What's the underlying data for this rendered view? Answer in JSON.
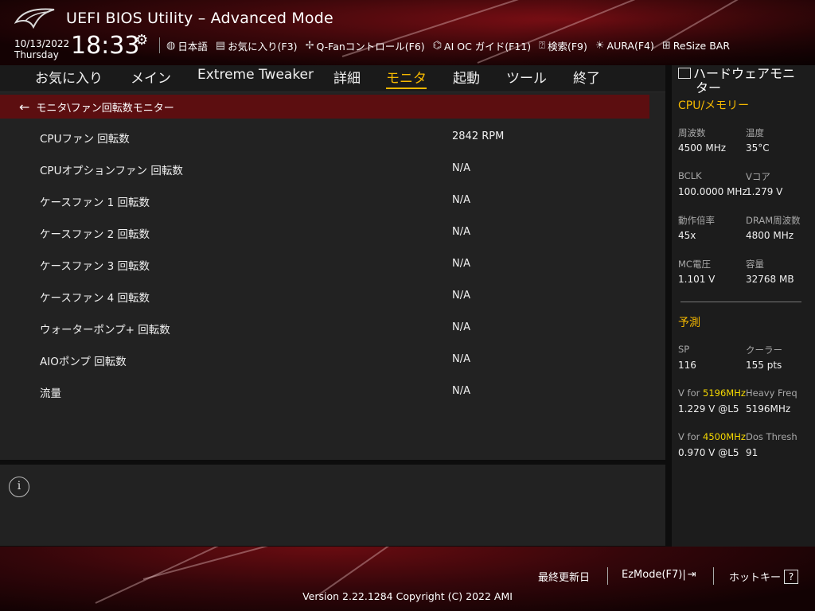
{
  "header": {
    "title": "UEFI BIOS Utility – Advanced Mode",
    "date": "10/13/2022",
    "day": "Thursday",
    "time": "18:33",
    "toolbar": [
      {
        "icon": "globe-icon",
        "label": "日本語"
      },
      {
        "icon": "favorites-icon",
        "label": "お気に入り(F3)"
      },
      {
        "icon": "fan-icon",
        "label": "Q-Fanコントロール(F6)"
      },
      {
        "icon": "ai-oc-icon",
        "label": "AI OC ガイド(F11)"
      },
      {
        "icon": "help-box-icon",
        "label": "検索(F9)"
      },
      {
        "icon": "aura-icon",
        "label": "AURA(F4)"
      },
      {
        "icon": "resize-bar-icon",
        "label": "ReSize BAR"
      }
    ]
  },
  "menu": {
    "items": [
      "お気に入り",
      "メイン",
      "Extreme Tweaker",
      "詳細",
      "モニタ",
      "起動",
      "ツール",
      "終了"
    ],
    "active": "モニタ"
  },
  "breadcrumb": "モニタ\\ファン回転数モニター",
  "rows": [
    {
      "label": "CPUファン 回転数",
      "value": "2842 RPM"
    },
    {
      "label": "CPUオプションファン 回転数",
      "value": "N/A"
    },
    {
      "label": "ケースファン 1 回転数",
      "value": "N/A"
    },
    {
      "label": "ケースファン 2 回転数",
      "value": "N/A"
    },
    {
      "label": "ケースファン 3 回転数",
      "value": "N/A"
    },
    {
      "label": "ケースファン 4 回転数",
      "value": "N/A"
    },
    {
      "label": "ウォーターポンプ+ 回転数",
      "value": "N/A"
    },
    {
      "label": "AIOポンプ 回転数",
      "value": "N/A"
    },
    {
      "label": "流量",
      "value": "N/A"
    }
  ],
  "hw": {
    "title_1": "ハードウェアモニ",
    "title_2": "ター",
    "section_cpu": "CPU/メモリー",
    "freq_label": "周波数",
    "freq_value": "4500 MHz",
    "temp_label": "温度",
    "temp_value": "35°C",
    "bclk_label": "BCLK",
    "bclk_value": "100.0000 MHz",
    "vcore_label": "Vコア",
    "vcore_value": "1.279 V",
    "ratio_label": "動作倍率",
    "ratio_value": "45x",
    "dram_label": "DRAM周波数",
    "dram_value": "4800 MHz",
    "mcv_label": "MC電圧",
    "mcv_value": "1.101 V",
    "cap_label": "容量",
    "cap_value": "32768 MB",
    "section_pred": "予測",
    "sp_label": "SP",
    "sp_value": "116",
    "cooler_label": "クーラー",
    "cooler_value": "155 pts",
    "vfor1_prefix": "V for ",
    "vfor1_freq": "5196MHz",
    "vfor1_value": "1.229 V @L5",
    "heavy_label": "Heavy Freq",
    "heavy_value": "5196MHz",
    "vfor2_prefix": "V for ",
    "vfor2_freq": "4500MHz",
    "vfor2_value": "0.970 V @L5",
    "dos_label": "Dos Thresh",
    "dos_value": "91"
  },
  "footer": {
    "last_modified": "最終更新日",
    "ezmode": "EzMode(F7)|",
    "hotkeys": "ホットキー",
    "hotkeys_box": "?",
    "version": "Version 2.22.1284 Copyright (C) 2022 AMI"
  },
  "colors": {
    "accent": "#f5b800",
    "breadcrumb_bg": "#5c0e10",
    "panel_bg": "#222222"
  }
}
